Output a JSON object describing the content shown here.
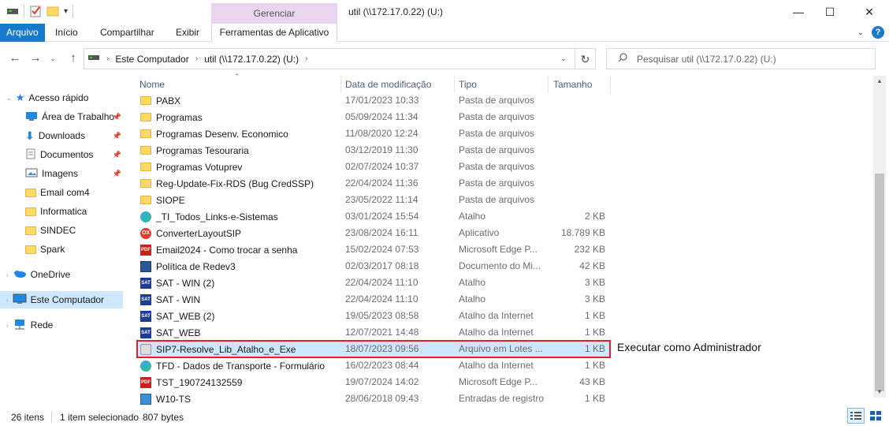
{
  "titlebar": {
    "context_tab": "Gerenciar",
    "window_title": "util (\\\\172.17.0.22) (U:)",
    "minimize": "—",
    "maximize": "☐",
    "close": "✕"
  },
  "ribbon": {
    "tabs": [
      "Arquivo",
      "Início",
      "Compartilhar",
      "Exibir",
      "Ferramentas de Aplicativo"
    ],
    "help": "?"
  },
  "address": {
    "segments": [
      "Este Computador",
      "util (\\\\172.17.0.22) (U:)"
    ],
    "search_placeholder": "Pesquisar util (\\\\172.17.0.22) (U:)"
  },
  "nav": {
    "items": [
      {
        "label": "Acesso rápido",
        "icon": "star-icon"
      },
      {
        "label": "Área de Trabalho",
        "icon": "desktop-icon",
        "pinned": true
      },
      {
        "label": "Downloads",
        "icon": "download-icon",
        "pinned": true
      },
      {
        "label": "Documentos",
        "icon": "document-icon",
        "pinned": true
      },
      {
        "label": "Imagens",
        "icon": "images-icon",
        "pinned": true
      },
      {
        "label": "Email com4",
        "icon": "folder-icon"
      },
      {
        "label": "Informatica",
        "icon": "folder-icon"
      },
      {
        "label": "SINDEC",
        "icon": "folder-icon"
      },
      {
        "label": "Spark",
        "icon": "folder-icon"
      },
      {
        "label": "OneDrive",
        "icon": "cloud-icon"
      },
      {
        "label": "Este Computador",
        "icon": "computer-icon",
        "selected": true
      },
      {
        "label": "Rede",
        "icon": "network-icon"
      }
    ]
  },
  "columns": {
    "name": "Nome",
    "date": "Data de modificação",
    "type": "Tipo",
    "size": "Tamanho"
  },
  "files": [
    {
      "name": "PABX",
      "date": "17/01/2023 10:33",
      "type": "Pasta de arquivos",
      "size": "",
      "icon": "folder"
    },
    {
      "name": "Programas",
      "date": "05/09/2024 11:34",
      "type": "Pasta de arquivos",
      "size": "",
      "icon": "folder"
    },
    {
      "name": "Programas Desenv. Economico",
      "date": "11/08/2020 12:24",
      "type": "Pasta de arquivos",
      "size": "",
      "icon": "folder"
    },
    {
      "name": "Programas Tesouraria",
      "date": "03/12/2019 11:30",
      "type": "Pasta de arquivos",
      "size": "",
      "icon": "folder"
    },
    {
      "name": "Programas Votuprev",
      "date": "02/07/2024 10:37",
      "type": "Pasta de arquivos",
      "size": "",
      "icon": "folder"
    },
    {
      "name": "Reg-Update-Fix-RDS (Bug CredSSP)",
      "date": "22/04/2024 11:36",
      "type": "Pasta de arquivos",
      "size": "",
      "icon": "folder"
    },
    {
      "name": "SIOPE",
      "date": "23/05/2022 11:14",
      "type": "Pasta de arquivos",
      "size": "",
      "icon": "folder"
    },
    {
      "name": "_TI_Todos_Links-e-Sistemas",
      "date": "03/01/2024 15:54",
      "type": "Atalho",
      "size": "2 KB",
      "icon": "edge"
    },
    {
      "name": "ConverterLayoutSIP",
      "date": "23/08/2024 16:11",
      "type": "Aplicativo",
      "size": "18.789 KB",
      "icon": "app"
    },
    {
      "name": "Email2024 - Como trocar a senha",
      "date": "15/02/2024 07:53",
      "type": "Microsoft Edge P...",
      "size": "232 KB",
      "icon": "pdf"
    },
    {
      "name": "Política de Redev3",
      "date": "02/03/2017 08:18",
      "type": "Documento do Mi...",
      "size": "42 KB",
      "icon": "word"
    },
    {
      "name": "SAT - WIN (2)",
      "date": "22/04/2024 11:10",
      "type": "Atalho",
      "size": "3 KB",
      "icon": "sat"
    },
    {
      "name": "SAT - WIN",
      "date": "22/04/2024 11:10",
      "type": "Atalho",
      "size": "3 KB",
      "icon": "sat"
    },
    {
      "name": "SAT_WEB (2)",
      "date": "19/05/2023 08:58",
      "type": "Atalho da Internet",
      "size": "1 KB",
      "icon": "sat"
    },
    {
      "name": "SAT_WEB",
      "date": "12/07/2021 14:48",
      "type": "Atalho da Internet",
      "size": "1 KB",
      "icon": "sat"
    },
    {
      "name": "SIP7-Resolve_Lib_Atalho_e_Exe",
      "date": "18/07/2023 09:56",
      "type": "Arquivo em Lotes ...",
      "size": "1 KB",
      "icon": "bat",
      "selected": true
    },
    {
      "name": "TFD - Dados de Transporte - Formulário",
      "date": "16/02/2023 08:44",
      "type": "Atalho da Internet",
      "size": "1 KB",
      "icon": "edge"
    },
    {
      "name": "TST_190724132559",
      "date": "19/07/2024 14:02",
      "type": "Microsoft Edge P...",
      "size": "43 KB",
      "icon": "pdf"
    },
    {
      "name": "W10-TS",
      "date": "28/06/2018 09:43",
      "type": "Entradas de registro",
      "size": "1 KB",
      "icon": "reg"
    }
  ],
  "annotation": "Executar como Administrador",
  "status": {
    "count": "26 itens",
    "selected": "1 item selecionado",
    "size": "807 bytes"
  }
}
